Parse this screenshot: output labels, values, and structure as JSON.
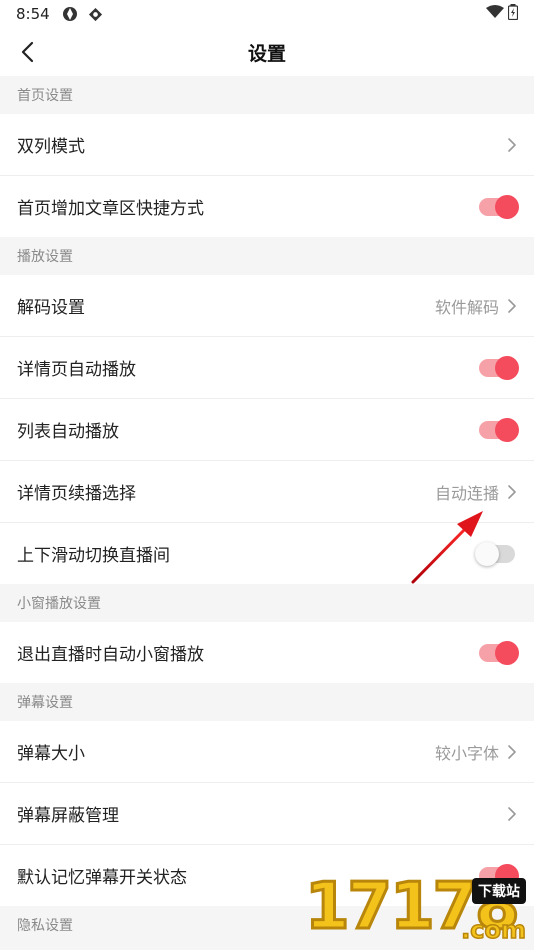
{
  "status_bar": {
    "time": "8:54"
  },
  "header": {
    "title": "设置"
  },
  "sections": [
    {
      "title": "首页设置",
      "rows": [
        {
          "label": "双列模式",
          "type": "link",
          "value": ""
        },
        {
          "label": "首页增加文章区快捷方式",
          "type": "toggle",
          "on": true
        }
      ]
    },
    {
      "title": "播放设置",
      "rows": [
        {
          "label": "解码设置",
          "type": "link",
          "value": "软件解码"
        },
        {
          "label": "详情页自动播放",
          "type": "toggle",
          "on": true
        },
        {
          "label": "列表自动播放",
          "type": "toggle",
          "on": true
        },
        {
          "label": "详情页续播选择",
          "type": "link",
          "value": "自动连播"
        },
        {
          "label": "上下滑动切换直播间",
          "type": "toggle",
          "on": false
        }
      ]
    },
    {
      "title": "小窗播放设置",
      "rows": [
        {
          "label": "退出直播时自动小窗播放",
          "type": "toggle",
          "on": true
        }
      ]
    },
    {
      "title": "弹幕设置",
      "rows": [
        {
          "label": "弹幕大小",
          "type": "link",
          "value": "较小字体"
        },
        {
          "label": "弹幕屏蔽管理",
          "type": "link",
          "value": ""
        },
        {
          "label": "默认记忆弹幕开关状态",
          "type": "toggle",
          "on": true
        }
      ]
    },
    {
      "title": "隐私设置",
      "rows": []
    }
  ],
  "watermark": {
    "digits": "17178",
    "badge": "下载站",
    "suffix": ".com"
  },
  "colors": {
    "accent": "#f44b5d",
    "accent_track": "#f6a1a8",
    "section_bg": "#f5f5f5",
    "annotation_arrow": "#e0151b"
  }
}
